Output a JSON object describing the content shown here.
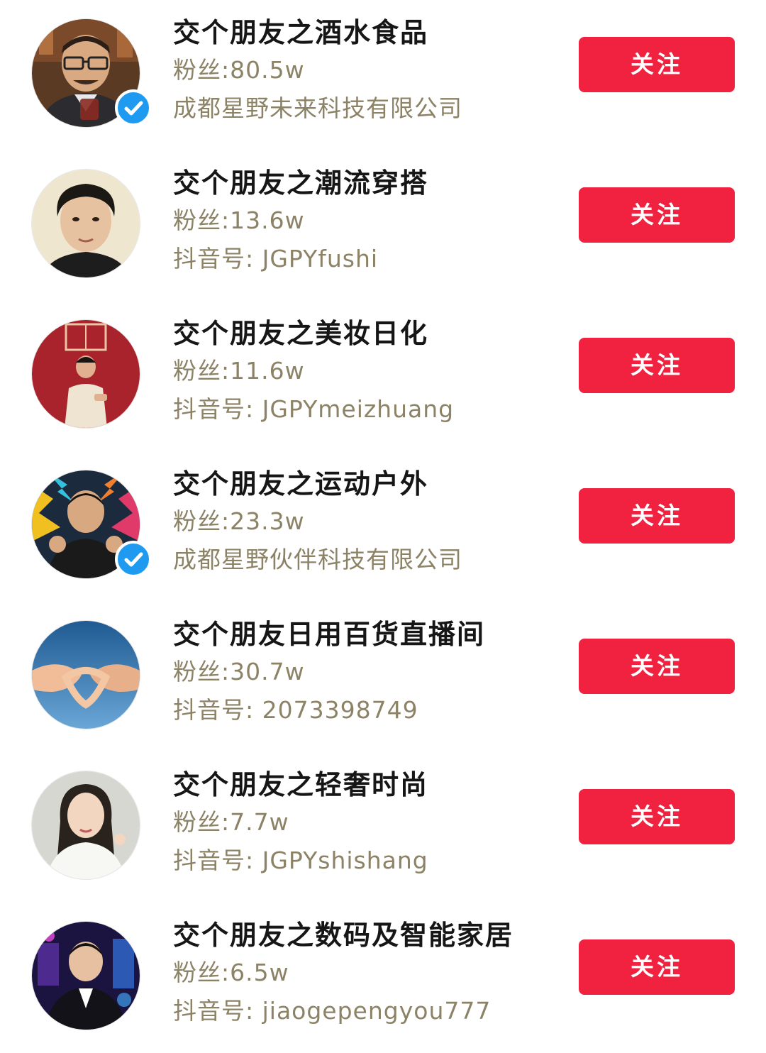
{
  "accent_color": "#f0223f",
  "verified_color": "#1e9bf0",
  "follow_label": "关注",
  "accounts": [
    {
      "name": "交个朋友之酒水食品",
      "fans": "粉丝:80.5w",
      "sub": "成都星野未来科技有限公司",
      "verified": true,
      "avatar_icon": "man-with-glasses-avatar"
    },
    {
      "name": "交个朋友之潮流穿搭",
      "fans": "粉丝:13.6w",
      "sub": "抖音号: JGPYfushi",
      "verified": false,
      "avatar_icon": "young-man-portrait-avatar"
    },
    {
      "name": "交个朋友之美妆日化",
      "fans": "粉丝:11.6w",
      "sub": "抖音号: JGPYmeizhuang",
      "verified": false,
      "avatar_icon": "man-on-red-background-avatar"
    },
    {
      "name": "交个朋友之运动户外",
      "fans": "粉丝:23.3w",
      "sub": "成都星野伙伴科技有限公司",
      "verified": true,
      "avatar_icon": "man-thumbs-up-avatar"
    },
    {
      "name": "交个朋友日用百货直播间",
      "fans": "粉丝:30.7w",
      "sub": "抖音号: 2073398749",
      "verified": false,
      "avatar_icon": "heart-hands-avatar"
    },
    {
      "name": "交个朋友之轻奢时尚",
      "fans": "粉丝:7.7w",
      "sub": "抖音号: JGPYshishang",
      "verified": false,
      "avatar_icon": "woman-portrait-avatar"
    },
    {
      "name": "交个朋友之数码及智能家居",
      "fans": "粉丝:6.5w",
      "sub": "抖音号: jiaogepengyou777",
      "verified": false,
      "avatar_icon": "man-in-suit-stage-avatar"
    }
  ]
}
